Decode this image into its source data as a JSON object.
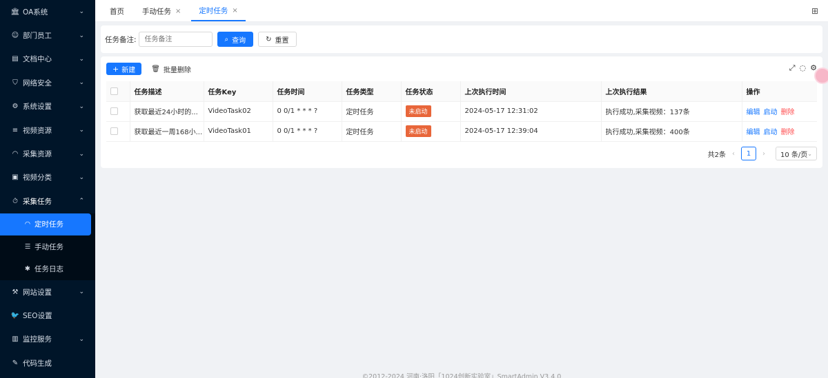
{
  "sidebar": {
    "menu_top": [
      {
        "label": "OA系统",
        "icon": "bank-icon",
        "glyph": "🏛"
      },
      {
        "label": "部门员工",
        "icon": "user-icon",
        "glyph": "☺"
      },
      {
        "label": "文档中心",
        "icon": "document-icon",
        "glyph": "▤"
      },
      {
        "label": "网络安全",
        "icon": "shield-icon",
        "glyph": "⛉"
      },
      {
        "label": "系统设置",
        "icon": "gear-icon",
        "glyph": "⚙"
      },
      {
        "label": "视频资源",
        "icon": "list-icon",
        "glyph": "≡"
      },
      {
        "label": "采集资源",
        "icon": "gauge-icon",
        "glyph": "◠"
      },
      {
        "label": "视频分类",
        "icon": "category-icon",
        "glyph": "▣"
      }
    ],
    "open_menu": {
      "label": "采集任务",
      "icon": "clock-icon",
      "glyph": "⏱"
    },
    "sub_items": [
      {
        "label": "定时任务",
        "icon": "dashboard-icon",
        "glyph": "◠"
      },
      {
        "label": "手动任务",
        "icon": "ordered-list-icon",
        "glyph": "☰"
      },
      {
        "label": "任务日志",
        "icon": "bug-icon",
        "glyph": "✱"
      }
    ],
    "menu_bottom": [
      {
        "label": "网站设置",
        "icon": "brush-icon",
        "glyph": "⚒",
        "has_chevron": true
      },
      {
        "label": "SEO设置",
        "icon": "twitter-icon",
        "glyph": "🐦",
        "has_chevron": false
      },
      {
        "label": "监控服务",
        "icon": "bar-chart-icon",
        "glyph": "▥",
        "has_chevron": true
      },
      {
        "label": "代码生成",
        "icon": "code-icon",
        "glyph": "✎",
        "has_chevron": false
      }
    ]
  },
  "tabs": [
    {
      "label": "首页",
      "closable": false
    },
    {
      "label": "手动任务",
      "closable": true
    },
    {
      "label": "定时任务",
      "closable": true,
      "active": true
    }
  ],
  "search": {
    "label": "任务备注:",
    "placeholder": "任务备注",
    "query_label": "查询",
    "reset_label": "重置"
  },
  "toolbar": {
    "new_label": "新建",
    "batch_delete_label": "批量删除"
  },
  "table": {
    "columns": [
      "任务描述",
      "任务Key",
      "任务时间",
      "任务类型",
      "任务状态",
      "上次执行时间",
      "上次执行结果",
      "操作"
    ],
    "rows": [
      {
        "desc": "获取最近24小时的...",
        "key": "VideoTask02",
        "time": "0 0/1 * * * ?",
        "type": "定时任务",
        "status": "未启动",
        "last_time": "2024-05-17 12:31:02",
        "last_result": "执行成功,采集视频：137条",
        "ops": [
          "编辑",
          "启动",
          "删除"
        ]
      },
      {
        "desc": "获取最近一周168小...",
        "key": "VideoTask01",
        "time": "0 0/1 * * * ?",
        "type": "定时任务",
        "status": "未启动",
        "last_time": "2024-05-17 12:39:04",
        "last_result": "执行成功,采集视频：400条",
        "ops": [
          "编辑",
          "启动",
          "删除"
        ]
      }
    ]
  },
  "pagination": {
    "total_label": "共2条",
    "current_page": "1",
    "page_size": "10 条/页"
  },
  "footer": "©2012-2024 河南·洛阳「1024创新实验室」SmartAdmin V3.4.0",
  "colors": {
    "primary": "#1677ff",
    "sidebar_bg": "#001529",
    "status_tag": "#e8663a",
    "danger": "#ff4d4f"
  }
}
